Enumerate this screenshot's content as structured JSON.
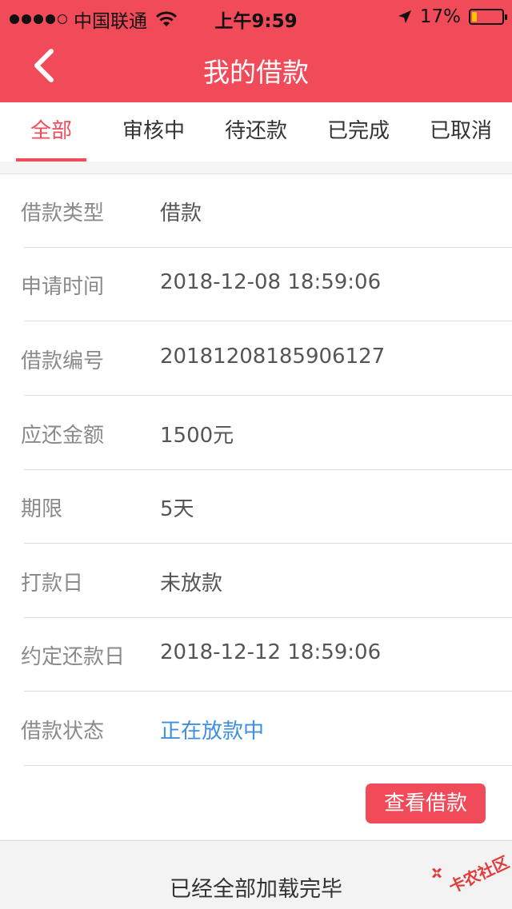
{
  "status_bar": {
    "carrier": "中国联通",
    "time": "上午9:59",
    "battery_text": "17%",
    "battery_level": 0.17,
    "signal_bars_filled": 4,
    "signal_bars_total": 5
  },
  "nav": {
    "title": "我的借款"
  },
  "tabs": [
    {
      "label": "全部",
      "active": true
    },
    {
      "label": "审核中",
      "active": false
    },
    {
      "label": "待还款",
      "active": false
    },
    {
      "label": "已完成",
      "active": false
    },
    {
      "label": "已取消",
      "active": false
    }
  ],
  "loan": {
    "rows": [
      {
        "label": "借款类型",
        "value": "借款"
      },
      {
        "label": "申请时间",
        "value": "2018-12-08 18:59:06"
      },
      {
        "label": "借款编号",
        "value": "20181208185906127"
      },
      {
        "label": "应还金额",
        "value": "1500元"
      },
      {
        "label": "期限",
        "value": "5天"
      },
      {
        "label": "打款日",
        "value": "未放款"
      },
      {
        "label": "约定还款日",
        "value": "2018-12-12 18:59:06"
      },
      {
        "label": "借款状态",
        "value": "正在放款中",
        "highlight": true
      }
    ],
    "view_button": "查看借款"
  },
  "footer": {
    "text": "已经全部加载完毕"
  },
  "watermark": {
    "text": "卡农社区"
  },
  "colors": {
    "brand": "#f14b5a",
    "status_blue": "#3d8fe0",
    "battery_low": "#f6c400"
  }
}
